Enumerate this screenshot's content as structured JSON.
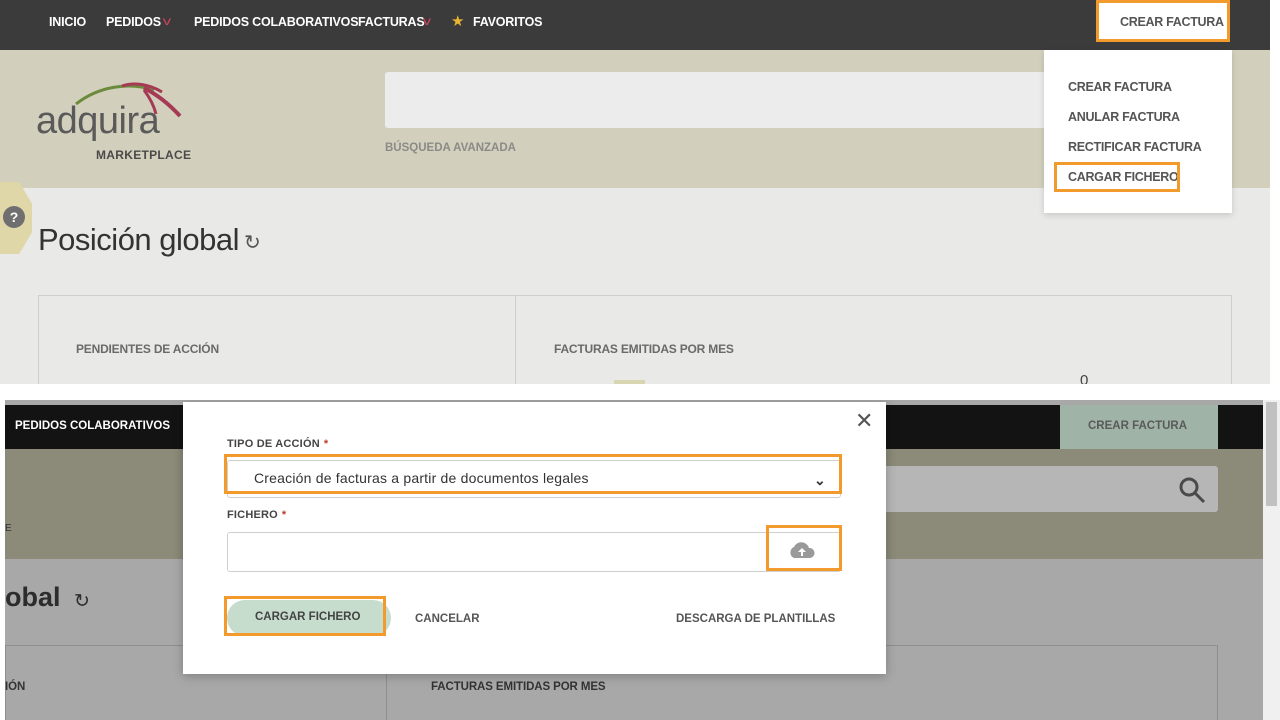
{
  "top_panel": {
    "nav": {
      "items": [
        "INICIO",
        "PEDIDOS",
        "PEDIDOS COLABORATIVOS",
        "FACTURAS",
        "FAVORITOS"
      ],
      "crear_factura": "CREAR FACTURA"
    },
    "logo": {
      "brand": "adquira",
      "sub": "MARKETPLACE"
    },
    "search": {
      "advanced_label": "BÚSQUEDA AVANZADA"
    },
    "page": {
      "title": "Posición global",
      "help_symbol": "?"
    },
    "cards": {
      "pending": "PENDIENTES DE ACCIÓN",
      "invoices_per_month": "FACTURAS EMITIDAS POR MES",
      "value": "0"
    },
    "dropdown": {
      "items": [
        "CREAR FACTURA",
        "ANULAR FACTURA",
        "RECTIFICAR FACTURA",
        "CARGAR FICHERO"
      ]
    }
  },
  "bottom_panel": {
    "nav": {
      "item": "PEDIDOS COLABORATIVOS",
      "crear_factura": "CREAR FACTURA"
    },
    "page": {
      "title_fragment": "obal",
      "edge_fragment": "E",
      "card_fragment": "IÓN",
      "card2_title": "FACTURAS EMITIDAS POR MES"
    },
    "modal": {
      "tipo_label": "TIPO DE ACCIÓN",
      "tipo_value": "Creación de facturas a partir de documentos legales",
      "fichero_label": "FICHERO",
      "required_mark": "*",
      "upload_button": "CARGAR FICHERO",
      "cancel": "CANCELAR",
      "templates": "DESCARGA DE PLANTILLAS"
    }
  },
  "colors": {
    "highlight": "#f39a2c",
    "nav_dark": "#3b3b3b",
    "brand_band": "#d2d0bd",
    "primary_button": "#c6dccc"
  }
}
